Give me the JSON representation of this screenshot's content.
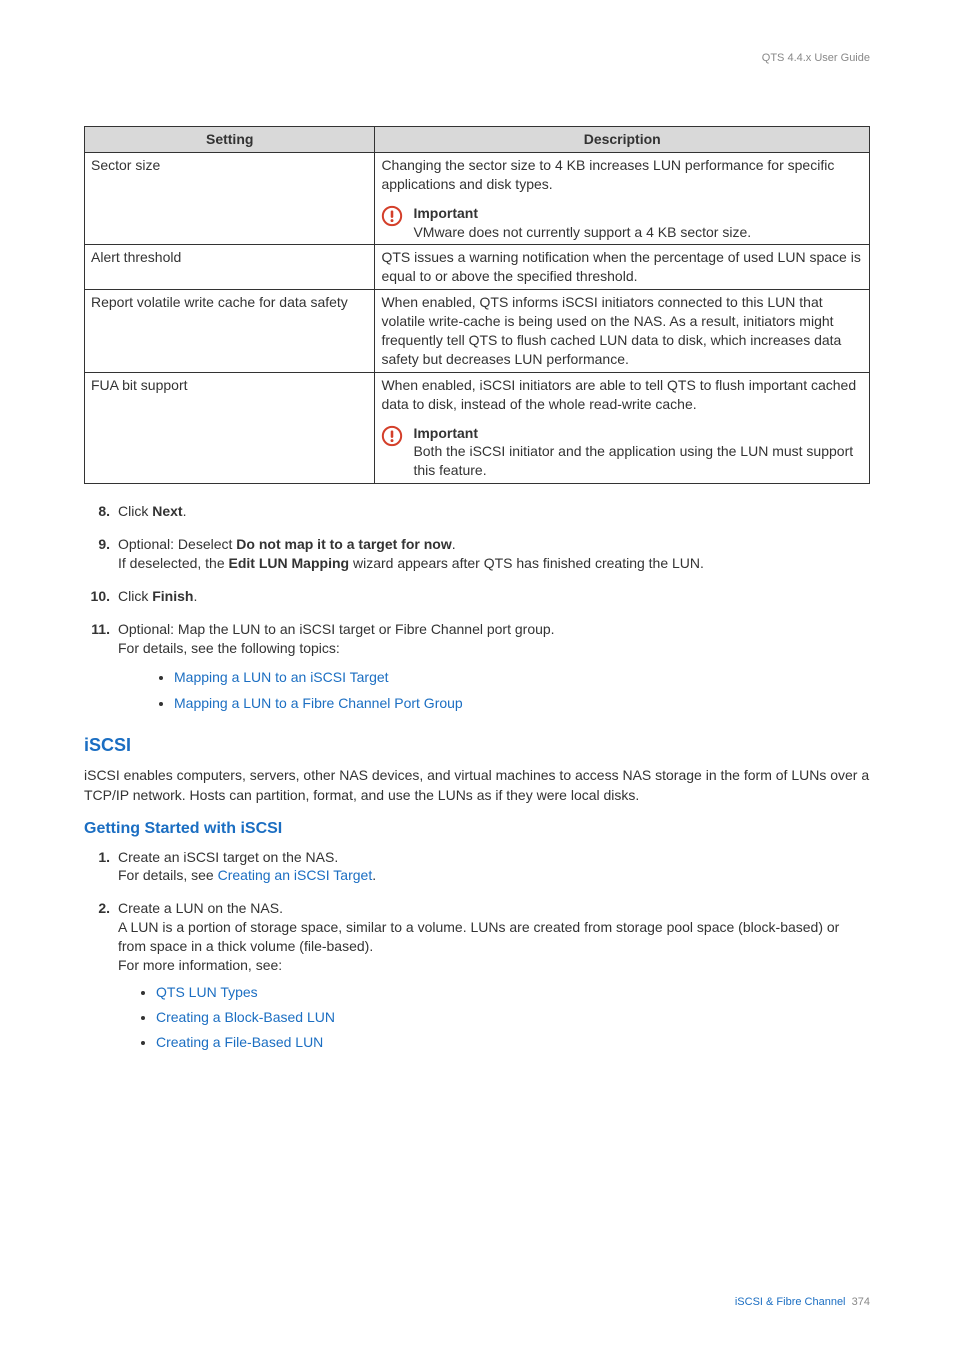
{
  "header": {
    "guide_title": "QTS 4.4.x User Guide"
  },
  "table": {
    "head_setting": "Setting",
    "head_desc": "Description",
    "rows": [
      {
        "setting": "Sector size",
        "desc": "Changing the sector size to 4 KB increases LUN performance for specific applications and disk types.",
        "note_title": "Important",
        "note_body": "VMware does not currently support a 4 KB sector size."
      },
      {
        "setting": "Alert threshold",
        "desc": "QTS issues a warning notification when the percentage of used LUN space is equal to or above the specified threshold."
      },
      {
        "setting": "Report volatile write cache for data safety",
        "desc": "When enabled, QTS informs iSCSI initiators connected to this LUN that volatile write-cache is being used on the NAS. As a result, initiators might frequently tell QTS to flush cached LUN data to disk, which increases data safety but decreases LUN performance."
      },
      {
        "setting": "FUA bit support",
        "desc": "When enabled, iSCSI initiators are able to tell QTS to flush important cached data to disk, instead of the whole read-write cache.",
        "note_title": "Important",
        "note_body": "Both the iSCSI initiator and the application using the LUN must support this feature."
      }
    ]
  },
  "steps_a": [
    {
      "num": "8.",
      "pre": "Click ",
      "bold": "Next",
      "post": "."
    },
    {
      "num": "9.",
      "line1_pre": "Optional: Deselect ",
      "line1_bold": "Do not map it to a target for now",
      "line1_post": ".",
      "line2_pre": "If deselected, the ",
      "line2_bold": "Edit LUN Mapping",
      "line2_post": " wizard appears after QTS has finished creating the LUN."
    },
    {
      "num": "10.",
      "pre": "Click ",
      "bold": "Finish",
      "post": "."
    },
    {
      "num": "11.",
      "line1": "Optional: Map the LUN to an iSCSI target or Fibre Channel port group.",
      "line2": "For details, see the following topics:",
      "sub": [
        "Mapping a LUN to an iSCSI Target",
        "Mapping a LUN to a Fibre Channel Port Group"
      ]
    }
  ],
  "iscsi": {
    "heading": "iSCSI",
    "para": "iSCSI enables computers, servers, other NAS devices, and virtual machines to access NAS storage in the form of LUNs over a TCP/IP network. Hosts can partition, format, and use the LUNs as if they were local disks."
  },
  "getting_started": {
    "heading": "Getting Started with iSCSI",
    "items": [
      {
        "num": "1.",
        "line1": "Create an iSCSI target on the NAS.",
        "line2_pre": "For details, see ",
        "line2_link": "Creating an iSCSI Target",
        "line2_post": "."
      },
      {
        "num": "2.",
        "line1": "Create a LUN on the NAS.",
        "line2": "A LUN is a portion of storage space, similar to a volume. LUNs are created from storage pool space (block-based) or from space in a thick volume (file-based).",
        "line3": "For more information, see:",
        "sub": [
          "QTS LUN Types",
          "Creating a Block-Based LUN",
          "Creating a File-Based LUN"
        ]
      }
    ]
  },
  "footer": {
    "section": "iSCSI & Fibre Channel",
    "page": "374"
  }
}
